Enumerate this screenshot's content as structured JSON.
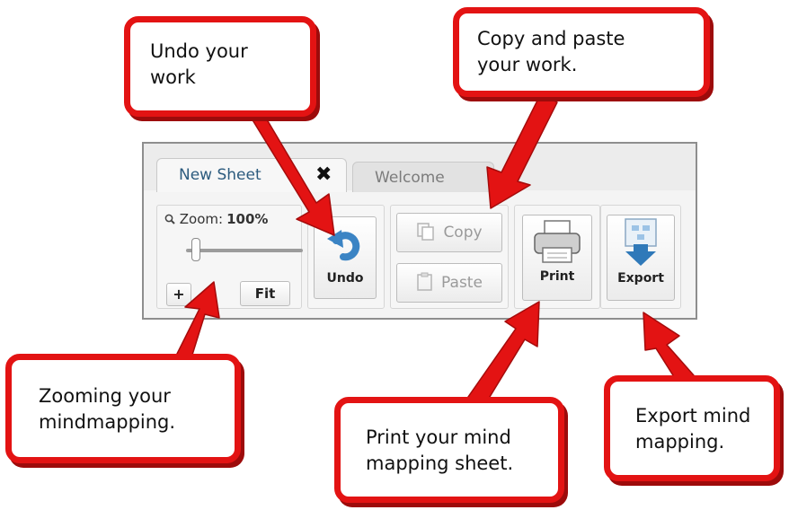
{
  "toolbar": {
    "tabs": [
      {
        "label": "New Sheet",
        "active": true,
        "close_glyph": "✖"
      },
      {
        "label": "Welcome",
        "active": false
      }
    ],
    "zoom": {
      "label": "Zoom:",
      "value_text": "100%",
      "icon": "magnifier-icon",
      "zoom_in_label": "+",
      "fit_label": "Fit"
    },
    "undo": {
      "label": "Undo",
      "icon": "undo-arrow-icon"
    },
    "copy": {
      "label": "Copy",
      "icon": "copy-icon",
      "enabled": false
    },
    "paste": {
      "label": "Paste",
      "icon": "paste-icon",
      "enabled": false
    },
    "print": {
      "label": "Print",
      "icon": "printer-icon"
    },
    "export": {
      "label": "Export",
      "icon": "export-icon"
    }
  },
  "callouts": {
    "undo": [
      "Undo your",
      "work"
    ],
    "copy": [
      "Copy and paste",
      "your work."
    ],
    "zoom": [
      "Zooming your",
      "mindmapping."
    ],
    "print": [
      "Print your mind",
      "mapping sheet."
    ],
    "export": [
      "Export mind",
      "mapping."
    ]
  },
  "colors": {
    "callout_border": "#e31313",
    "arrow": "#e31313",
    "tab_text": "#2c5b7e"
  }
}
